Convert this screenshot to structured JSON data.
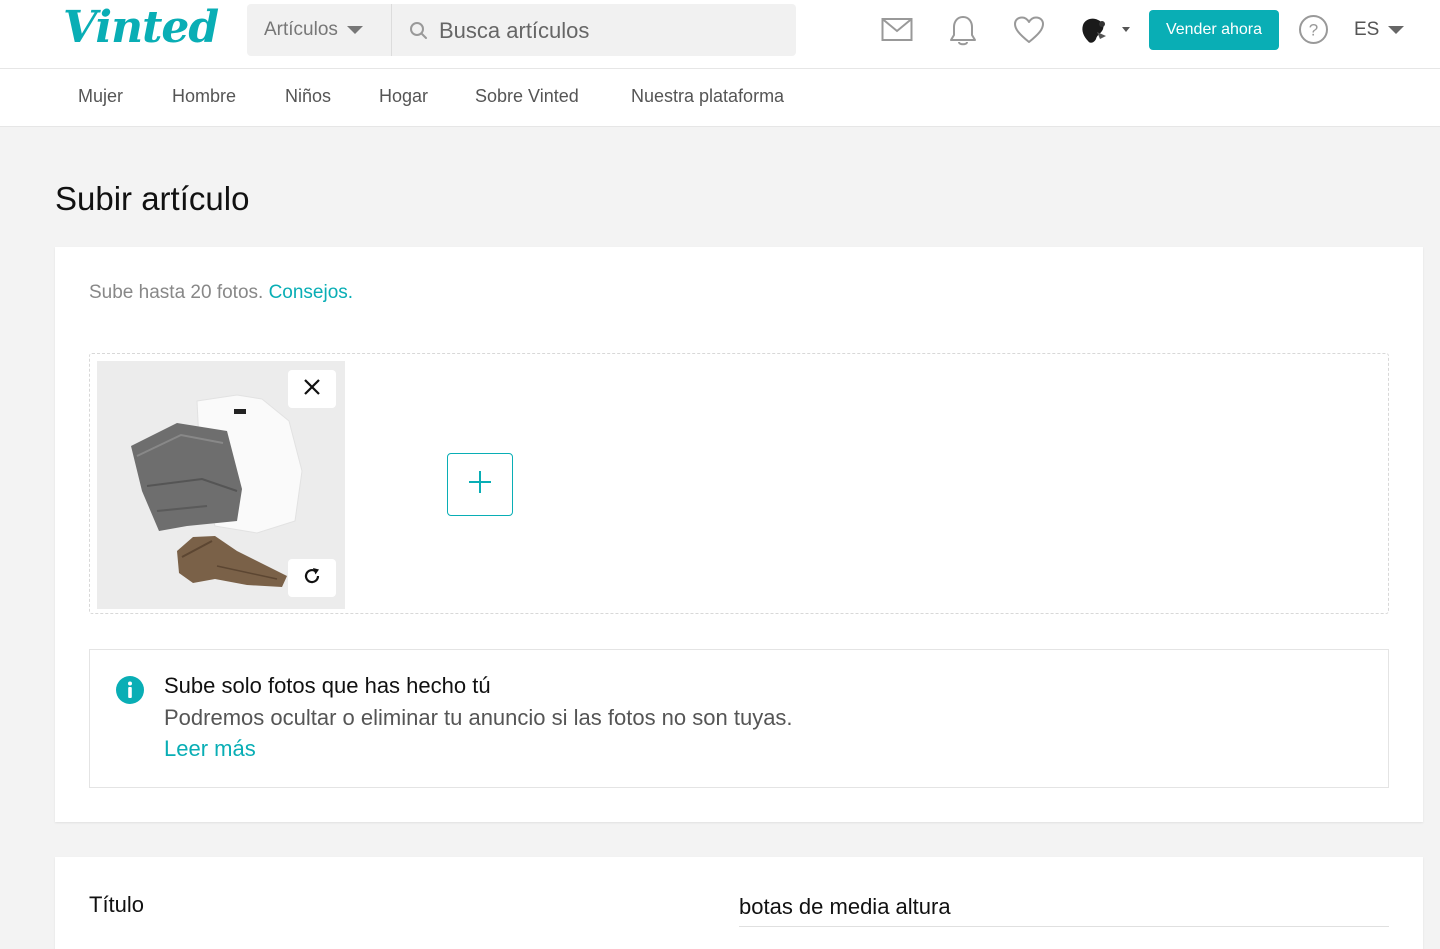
{
  "header": {
    "logo": "Vinted",
    "search": {
      "category": "Artículos",
      "placeholder": "Busca artículos"
    },
    "icons": [
      "mail-icon",
      "bell-icon",
      "heart-icon",
      "avatar",
      "help-icon"
    ],
    "sell_label": "Vender ahora",
    "language": "ES"
  },
  "nav": {
    "items": [
      "Mujer",
      "Hombre",
      "Niños",
      "Hogar",
      "Sobre Vinted",
      "Nuestra plataforma"
    ]
  },
  "page": {
    "title": "Subir artículo"
  },
  "photos": {
    "hint": "Sube hasta 20 fotos.",
    "tips_link": "Consejos.",
    "notice": {
      "title": "Sube solo fotos que has hecho tú",
      "body": "Podremos ocultar o eliminar tu anuncio si las fotos no son tuyas.",
      "link": "Leer más"
    }
  },
  "form": {
    "title_label": "Título",
    "title_value": "botas de media altura"
  },
  "colors": {
    "accent": "#09aeb5",
    "background": "#f3f3f3"
  }
}
